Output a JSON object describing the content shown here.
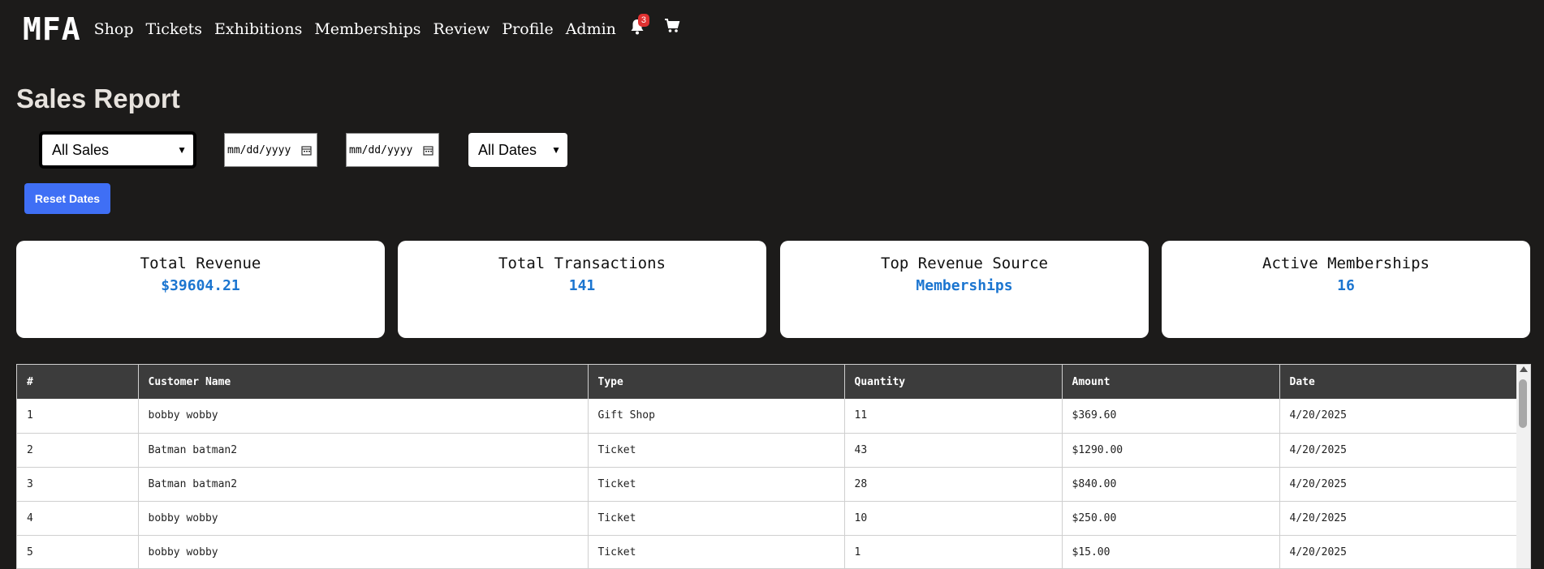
{
  "nav": {
    "logo": "MFA",
    "links": [
      "Shop",
      "Tickets",
      "Exhibitions",
      "Memberships",
      "Review",
      "Profile",
      "Admin"
    ],
    "notification_count": "3",
    "icons": [
      "bell-icon",
      "cart-icon"
    ]
  },
  "page": {
    "title": "Sales Report"
  },
  "filters": {
    "sales_type": "All Sales",
    "start_date_placeholder": "mm/dd/yyyy",
    "end_date_placeholder": "mm/dd/yyyy",
    "date_range": "All Dates",
    "reset_label": "Reset Dates"
  },
  "cards": [
    {
      "title": "Total Revenue",
      "value": "$39604.21"
    },
    {
      "title": "Total Transactions",
      "value": "141"
    },
    {
      "title": "Top Revenue Source",
      "value": "Memberships"
    },
    {
      "title": "Active Memberships",
      "value": "16"
    }
  ],
  "table": {
    "headers": [
      "#",
      "Customer Name",
      "Type",
      "Quantity",
      "Amount",
      "Date"
    ],
    "rows": [
      [
        "1",
        "bobby wobby",
        "Gift Shop",
        "11",
        "$369.60",
        "4/20/2025"
      ],
      [
        "2",
        "Batman batman2",
        "Ticket",
        "43",
        "$1290.00",
        "4/20/2025"
      ],
      [
        "3",
        "Batman batman2",
        "Ticket",
        "28",
        "$840.00",
        "4/20/2025"
      ],
      [
        "4",
        "bobby wobby",
        "Ticket",
        "10",
        "$250.00",
        "4/20/2025"
      ],
      [
        "5",
        "bobby wobby",
        "Ticket",
        "1",
        "$15.00",
        "4/20/2025"
      ]
    ]
  },
  "colors": {
    "background": "#1c1b1a",
    "accent_button": "#3f6ff5",
    "card_value": "#1b75d0",
    "table_header": "#3c3c3c",
    "badge": "#e03131"
  }
}
